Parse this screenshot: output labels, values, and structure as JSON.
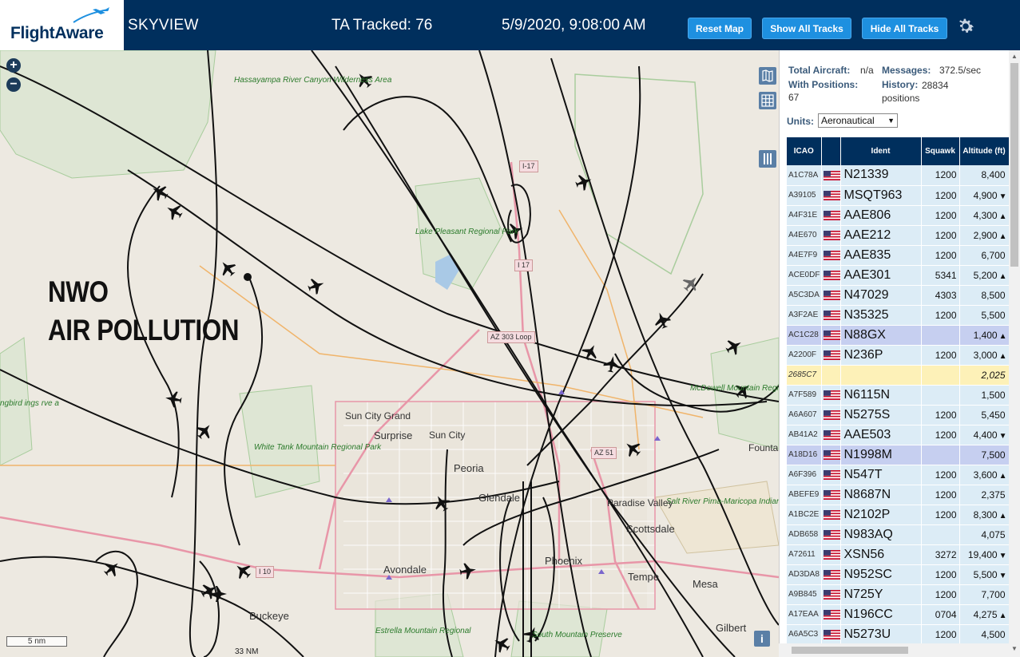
{
  "header": {
    "logo_text": "FlightAware",
    "app_title": "SKYVIEW",
    "tracked": "TA Tracked: 76",
    "datetime": "5/9/2020, 9:08:00 AM",
    "reset_label": "Reset Map",
    "show_label": "Show All Tracks",
    "hide_label": "Hide All Tracks",
    "settings_icon": "gear-icon"
  },
  "map": {
    "overlay_line1": "NWO",
    "overlay_line2": "AIR POLLUTION",
    "scale_label": "5 nm",
    "scale_nm": "33 NM",
    "zoom_in": "+",
    "zoom_out": "−",
    "info": "i",
    "places": {
      "sun_city_grand": "Sun City Grand",
      "surprise": "Surprise",
      "sun_city": "Sun City",
      "peoria": "Peoria",
      "glendale": "Glendale",
      "paradise_valley": "Paradise Valley",
      "scottsdale": "Scottsdale",
      "phoenix": "Phoenix",
      "tempe": "Tempe",
      "mesa": "Mesa",
      "avondale": "Avondale",
      "buckeye": "Buckeye",
      "gilbert": "Gilbert",
      "fountain": "Fountain"
    },
    "parks": {
      "hassayampa": "Hassayampa River Canyon Wilderness Area",
      "lake_pleasant": "Lake Pleasant Regional Park",
      "white_tank": "White Tank Mountain Regional Park",
      "mcdowell": "McDowell Mountain Regional Park",
      "salt_river": "Salt River Pima-Maricopa Indian Community",
      "estrella": "Estrella Mountain Regional",
      "south_mountain": "South Mountain Preserve",
      "skyline": "ngbird ings rve a"
    },
    "shields": {
      "i17_top": "I-17",
      "i17_mid": "I 17",
      "az303": "AZ 303 Loop",
      "az51": "AZ 51",
      "i10": "I 10"
    }
  },
  "panel": {
    "total_label": "Total Aircraft:",
    "total_value": "n/a",
    "messages_label": "Messages:",
    "messages_value": "372.5/sec",
    "positions_label": "With Positions:",
    "positions_value": "67",
    "history_label": "History:",
    "history_value": "28834 positions",
    "units_label": "Units:",
    "units_value": "Aeronautical",
    "columns": {
      "icao": "ICAO",
      "ident": "Ident",
      "squawk": "Squawk",
      "altitude": "Altitude (ft)"
    },
    "rows": [
      {
        "icao": "A1C78A",
        "flag": true,
        "ident": "N21339",
        "squawk": "1200",
        "alt": "8,400",
        "trend": "",
        "style": ""
      },
      {
        "icao": "A39105",
        "flag": true,
        "ident": "MSQT963",
        "squawk": "1200",
        "alt": "4,900",
        "trend": "▼",
        "style": ""
      },
      {
        "icao": "A4F31E",
        "flag": true,
        "ident": "AAE806",
        "squawk": "1200",
        "alt": "4,300",
        "trend": "▲",
        "style": ""
      },
      {
        "icao": "A4E670",
        "flag": true,
        "ident": "AAE212",
        "squawk": "1200",
        "alt": "2,900",
        "trend": "▲",
        "style": ""
      },
      {
        "icao": "A4E7F9",
        "flag": true,
        "ident": "AAE835",
        "squawk": "1200",
        "alt": "6,700",
        "trend": "",
        "style": ""
      },
      {
        "icao": "ACE0DF",
        "flag": true,
        "ident": "AAE301",
        "squawk": "5341",
        "alt": "5,200",
        "trend": "▲",
        "style": ""
      },
      {
        "icao": "A5C3DA",
        "flag": true,
        "ident": "N47029",
        "squawk": "4303",
        "alt": "8,500",
        "trend": "",
        "style": ""
      },
      {
        "icao": "A3F2AE",
        "flag": true,
        "ident": "N35325",
        "squawk": "1200",
        "alt": "5,500",
        "trend": "",
        "style": ""
      },
      {
        "icao": "AC1C28",
        "flag": true,
        "ident": "N88GX",
        "squawk": "",
        "alt": "1,400",
        "trend": "▲",
        "style": "sel"
      },
      {
        "icao": "A2200F",
        "flag": true,
        "ident": "N236P",
        "squawk": "1200",
        "alt": "3,000",
        "trend": "▲",
        "style": ""
      },
      {
        "icao": "2685C7",
        "flag": false,
        "ident": "",
        "squawk": "",
        "alt": "2,025",
        "trend": "",
        "style": "yel"
      },
      {
        "icao": "A7F589",
        "flag": true,
        "ident": "N6115N",
        "squawk": "",
        "alt": "1,500",
        "trend": "",
        "style": ""
      },
      {
        "icao": "A6A607",
        "flag": true,
        "ident": "N5275S",
        "squawk": "1200",
        "alt": "5,450",
        "trend": "",
        "style": ""
      },
      {
        "icao": "AB41A2",
        "flag": true,
        "ident": "AAE503",
        "squawk": "1200",
        "alt": "4,400",
        "trend": "▼",
        "style": ""
      },
      {
        "icao": "A18D16",
        "flag": true,
        "ident": "N1998M",
        "squawk": "",
        "alt": "7,500",
        "trend": "",
        "style": "sel"
      },
      {
        "icao": "A6F396",
        "flag": true,
        "ident": "N547T",
        "squawk": "1200",
        "alt": "3,600",
        "trend": "▲",
        "style": ""
      },
      {
        "icao": "ABEFE9",
        "flag": true,
        "ident": "N8687N",
        "squawk": "1200",
        "alt": "2,375",
        "trend": "",
        "style": ""
      },
      {
        "icao": "A1BC2E",
        "flag": true,
        "ident": "N2102P",
        "squawk": "1200",
        "alt": "8,300",
        "trend": "▲",
        "style": ""
      },
      {
        "icao": "ADB658",
        "flag": true,
        "ident": "N983AQ",
        "squawk": "",
        "alt": "4,075",
        "trend": "",
        "style": ""
      },
      {
        "icao": "A72611",
        "flag": true,
        "ident": "XSN56",
        "squawk": "3272",
        "alt": "19,400",
        "trend": "▼",
        "style": ""
      },
      {
        "icao": "AD3DA8",
        "flag": true,
        "ident": "N952SC",
        "squawk": "1200",
        "alt": "5,500",
        "trend": "▼",
        "style": ""
      },
      {
        "icao": "A9B845",
        "flag": true,
        "ident": "N725Y",
        "squawk": "1200",
        "alt": "7,700",
        "trend": "",
        "style": ""
      },
      {
        "icao": "A17EAA",
        "flag": true,
        "ident": "N196CC",
        "squawk": "0704",
        "alt": "4,275",
        "trend": "▲",
        "style": ""
      },
      {
        "icao": "A6A5C3",
        "flag": true,
        "ident": "N5273U",
        "squawk": "1200",
        "alt": "4,500",
        "trend": "",
        "style": ""
      }
    ]
  },
  "colors": {
    "header_bg": "#002f5d",
    "button": "#1e90e0",
    "row": "#dcecf6",
    "row_selected": "#c6cff0",
    "row_highlight": "#fdf1b8"
  }
}
